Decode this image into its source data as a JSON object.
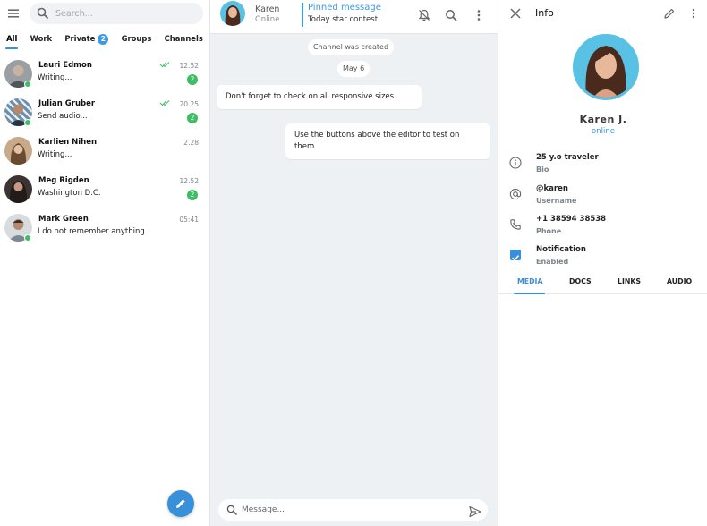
{
  "sidebar": {
    "search_placeholder": "Search...",
    "tabs": [
      {
        "label": "All",
        "active": true
      },
      {
        "label": "Work"
      },
      {
        "label": "Private",
        "badge": "2"
      },
      {
        "label": "Groups"
      },
      {
        "label": "Channels"
      }
    ],
    "chats": [
      {
        "name": "Lauri Edmon",
        "preview": "Writing...",
        "time": "12.52",
        "unread": "2",
        "online": true,
        "read": true
      },
      {
        "name": "Julian Gruber",
        "preview": "Send audio...",
        "time": "20.25",
        "unread": "2",
        "online": true,
        "read": true
      },
      {
        "name": "Karlien Nihen",
        "preview": "Writing...",
        "time": "2.28"
      },
      {
        "name": "Meg Rigden",
        "preview": "Washington D.C.",
        "time": "12.52",
        "unread": "2"
      },
      {
        "name": "Mark Green",
        "preview": "I do not remember anything",
        "time": "05:41",
        "online": true
      }
    ]
  },
  "chat": {
    "contact_name": "Karen",
    "contact_status": "Online",
    "pinned_title": "Pinned message",
    "pinned_text": "Today star contest",
    "system_messages": [
      "Channel was created",
      "May 6"
    ],
    "messages": [
      {
        "text": "Don't forget to check on all responsive sizes.",
        "side": "in"
      },
      {
        "text": "Use the buttons above the editor to test on them",
        "side": "out"
      }
    ],
    "composer_placeholder": "Message..."
  },
  "info": {
    "title": "Info",
    "name": "Karen J.",
    "status": "online",
    "rows": [
      {
        "value": "25 y.o traveler",
        "label": "Bio",
        "icon": "info-icon"
      },
      {
        "value": "@karen",
        "label": "Username",
        "icon": "at-icon"
      },
      {
        "value": "+1 38594 38538",
        "label": "Phone",
        "icon": "phone-icon"
      },
      {
        "value": "Notification",
        "label": "Enabled",
        "icon": "checkbox-icon"
      }
    ],
    "tabs": [
      "MEDIA",
      "DOCS",
      "LINKS",
      "AUDIO"
    ]
  },
  "colors": {
    "accent": "#3b9ae4",
    "online": "#3fbd61",
    "avatar_ring": "#59c1e3",
    "chat_background": "#eef1f4"
  }
}
